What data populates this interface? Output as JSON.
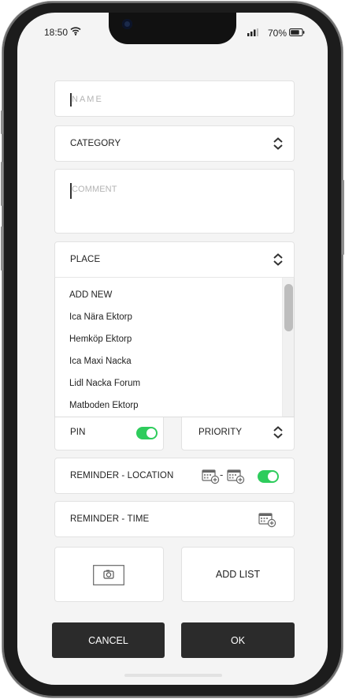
{
  "status_bar": {
    "time": "18:50",
    "battery": "70%",
    "wifi_icon": "wifi-icon",
    "signal_icon": "signal-icon",
    "battery_icon": "battery-icon"
  },
  "form": {
    "name": {
      "value": "",
      "placeholder": "NAME"
    },
    "category": {
      "label": "CATEGORY"
    },
    "comment": {
      "value": "",
      "placeholder": "COMMENT"
    },
    "place": {
      "label": "PLACE",
      "expanded": true,
      "options": [
        "ADD NEW",
        "Ica Nära Ektorp",
        "Hemköp Ektorp",
        "Ica Maxi Nacka",
        "Lidl Nacka Forum",
        "Matboden Ektorp"
      ]
    },
    "pin": {
      "label": "PIN",
      "on": true
    },
    "priority": {
      "label": "PRIORITY"
    },
    "reminder_location": {
      "label": "REMINDER - LOCATION",
      "separator": "-",
      "on": true
    },
    "reminder_time": {
      "label": "REMINDER - TIME"
    },
    "photo": {
      "icon": "camera-icon"
    },
    "add_list": {
      "label": "ADD LIST"
    }
  },
  "actions": {
    "cancel": "CANCEL",
    "ok": "OK"
  },
  "colors": {
    "toggle_on": "#2ecc5c",
    "button_dark": "#2b2b2b",
    "screen_bg": "#f4f4f4"
  }
}
